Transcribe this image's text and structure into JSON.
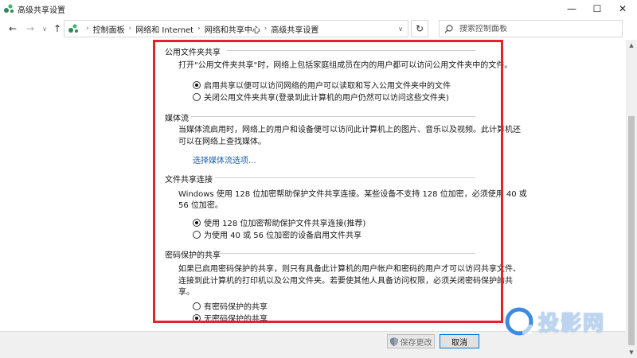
{
  "window": {
    "title": "高级共享设置",
    "min_glyph": "—",
    "max_glyph": "☐",
    "close_glyph": "✕"
  },
  "nav": {
    "back_glyph": "←",
    "forward_glyph": "→",
    "dropdown_glyph": "∨",
    "up_glyph": "↑",
    "refresh_glyph": "↻"
  },
  "address": {
    "breadcrumbs": [
      "控制面板",
      "网络和 Internet",
      "网络和共享中心",
      "高级共享设置"
    ],
    "separator": "›",
    "dropdown_glyph": "∨"
  },
  "search": {
    "placeholder": "搜索控制面板"
  },
  "sections": {
    "public_folder": {
      "title": "公用文件夹共享",
      "description": "打开\"公用文件夹共享\"时，网络上包括家庭组成员在内的用户都可以访问公用文件夹中的文件。",
      "options": [
        {
          "label": "启用共享以便可以访问网络的用户可以读取和写入公用文件夹中的文件",
          "checked": true
        },
        {
          "label": "关闭公用文件夹共享(登录到此计算机的用户仍然可以访问这些文件夹)",
          "checked": false
        }
      ]
    },
    "media": {
      "title": "媒体流",
      "description_line1": "当媒体流启用时，网络上的用户和设备便可以访问此计算机上的图片、音乐以及视频。此计算机还",
      "description_line2": "可以在网络上查找媒体。",
      "link": "选择媒体流选项..."
    },
    "file_sharing": {
      "title": "文件共享连接",
      "description_line1": "Windows 使用 128 位加密帮助保护文件共享连接。某些设备不支持 128 位加密，必须使用 40 或",
      "description_line2": "56 位加密。",
      "options": [
        {
          "label": "使用 128 位加密帮助保护文件共享连接(推荐)",
          "checked": true
        },
        {
          "label": "为使用 40 或 56 位加密的设备启用文件共享",
          "checked": false
        }
      ]
    },
    "password": {
      "title": "密码保护的共享",
      "description_line1": "如果已启用密码保护的共享，则只有具备此计算机的用户帐户和密码的用户才可以访问共享文件、",
      "description_line2": "连接到此计算机的打印机以及公用文件夹。若要使其他人具备访问权限，必须关闭密码保护的共",
      "description_line3": "享。",
      "options": [
        {
          "label": "有密码保护的共享",
          "checked": false
        },
        {
          "label": "无密码保护的共享",
          "checked": true
        }
      ]
    }
  },
  "buttons": {
    "save": "保存更改",
    "cancel": "取消"
  },
  "watermark": {
    "text": "投影网"
  },
  "colors": {
    "highlight": "#e0242b",
    "link": "#1a5fb4"
  }
}
